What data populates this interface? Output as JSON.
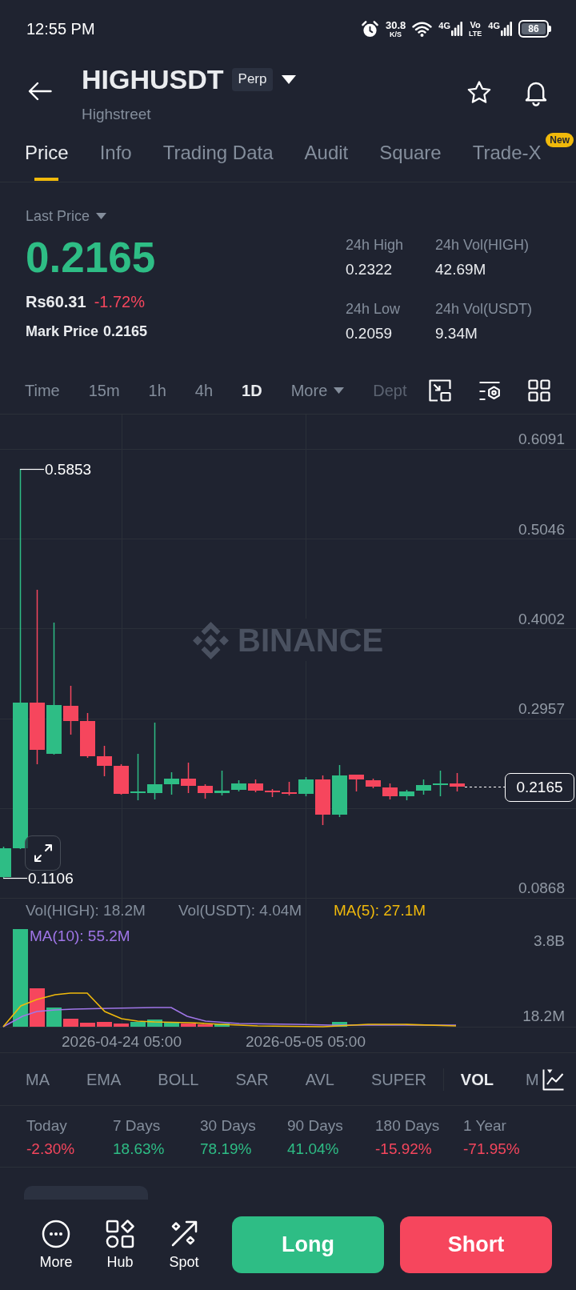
{
  "status_bar": {
    "time": "12:55 PM",
    "data_speed": "30.8",
    "data_speed_unit": "K/S",
    "networks": [
      {
        "type": "4G"
      },
      {
        "type": "4G"
      }
    ],
    "volte": [
      "Vo",
      "LTE"
    ],
    "battery": "86"
  },
  "header": {
    "symbol": "HIGHUSDT",
    "badge": "Perp",
    "name": "Highstreet"
  },
  "tabs": [
    {
      "label": "Price",
      "selected": true
    },
    {
      "label": "Info",
      "selected": false
    },
    {
      "label": "Trading Data",
      "selected": false
    },
    {
      "label": "Audit",
      "selected": false
    },
    {
      "label": "Square",
      "selected": false
    },
    {
      "label": "Trade-X",
      "selected": false,
      "badge": "New"
    }
  ],
  "price": {
    "label": "Last Price",
    "value": "0.2165",
    "falling": false,
    "fiat": "Rs60.31",
    "change": "-1.72%",
    "change_falling": true,
    "mark_label": "Mark Price",
    "mark_value": "0.2165"
  },
  "stats": [
    {
      "label": "24h High",
      "value": "0.2322"
    },
    {
      "label": "24h Vol(HIGH)",
      "value": "42.69M"
    },
    {
      "label": "24h Low",
      "value": "0.2059"
    },
    {
      "label": "24h Vol(USDT)",
      "value": "9.34M"
    }
  ],
  "chart_toolbar": {
    "intervals": [
      {
        "label": "Time",
        "selected": false
      },
      {
        "label": "15m",
        "selected": false
      },
      {
        "label": "1h",
        "selected": false
      },
      {
        "label": "4h",
        "selected": false
      },
      {
        "label": "1D",
        "selected": true
      }
    ],
    "more": "More",
    "depth": "Dept"
  },
  "chart": {
    "watermark": "BINANCE",
    "price_axis": [
      "0.6091",
      "0.5046",
      "0.4002",
      "0.2957",
      "0.0868"
    ],
    "high_marker": "0.5853",
    "low_marker": "0.1106",
    "last_price_tag": "0.2165",
    "volume_legend": [
      {
        "label": "Vol(HIGH): 18.2M",
        "kind": "volume",
        "color": "#848e9c"
      },
      {
        "label": "Vol(USDT): 4.04M",
        "kind": "volume",
        "color": "#848e9c"
      },
      {
        "label": "MA(5): 27.1M",
        "kind": "ma5",
        "color": "#f0b90b"
      },
      {
        "label": "MA(10): 55.2M",
        "kind": "ma10",
        "color": "#a076e8"
      }
    ],
    "volume_axis": [
      "3.8B",
      "18.2M"
    ],
    "time_axis": [
      "2026-04-24 05:00",
      "2026-05-05 05:00"
    ]
  },
  "indicators": {
    "main": [
      {
        "label": "MA",
        "selected": false
      },
      {
        "label": "EMA",
        "selected": false
      },
      {
        "label": "BOLL",
        "selected": false
      },
      {
        "label": "SAR",
        "selected": false
      },
      {
        "label": "AVL",
        "selected": false
      },
      {
        "label": "SUPER",
        "selected": false
      }
    ],
    "sub": [
      {
        "label": "VOL",
        "selected": true
      },
      {
        "label": "M",
        "selected": false
      }
    ]
  },
  "performance": [
    {
      "label": "Today",
      "value": "-2.30%",
      "falling": true
    },
    {
      "label": "7 Days",
      "value": "18.63%",
      "falling": false
    },
    {
      "label": "30 Days",
      "value": "78.19%",
      "falling": false
    },
    {
      "label": "90 Days",
      "value": "41.04%",
      "falling": false
    },
    {
      "label": "180 Days",
      "value": "-15.92%",
      "falling": true
    },
    {
      "label": "1 Year",
      "value": "-71.95%",
      "falling": true
    }
  ],
  "actions": {
    "buttons": [
      {
        "label": "More",
        "kind": "more"
      },
      {
        "label": "Hub",
        "kind": "hub"
      },
      {
        "label": "Spot",
        "kind": "spot"
      }
    ],
    "long": "Long",
    "short": "Short"
  }
}
